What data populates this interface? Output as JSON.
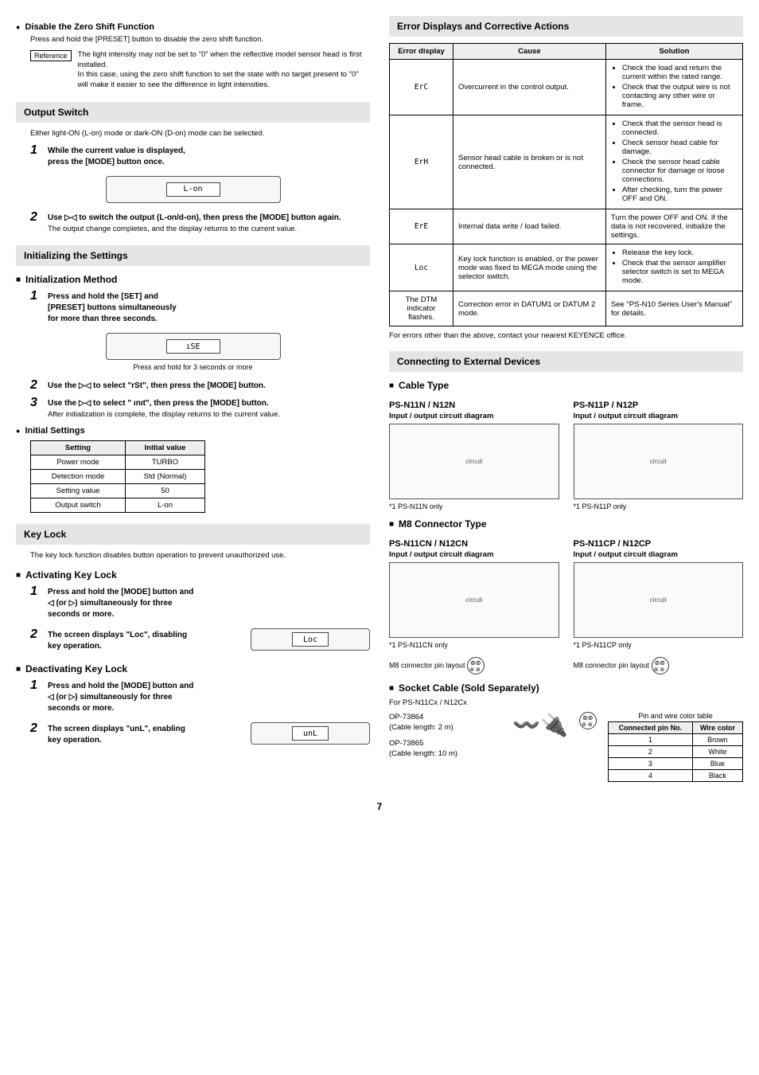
{
  "left": {
    "dz_head": "Disable the Zero Shift Function",
    "dz_body": "Press and hold the [PRESET] button to disable the zero shift function.",
    "ref_label": "Reference",
    "ref_text1": "The light intensity may not be set to \"0\" when the reflective model sensor head is first installed.",
    "ref_text2": "In this case, using the zero shift function to set the state with no target present to \"0\" will make it easier to see the difference in light intensities.",
    "out_sw": "Output Switch",
    "out_sw_body": "Either light-ON (L-on) mode or dark-ON (D-on) mode can be selected.",
    "out_step1a": "While the current value is displayed,",
    "out_step1b": "press the [MODE] button once.",
    "amp_lcd1": "L-on",
    "out_step2": "Use ▷◁ to switch the output (L-on/d-on), then press the [MODE] button again.",
    "out_step2b": "The output change completes, and the display returns to the current value.",
    "init_head": "Initializing the Settings",
    "init_method": "Initialization Method",
    "init_step1a": "Press and hold the [SET] and",
    "init_step1b": "[PRESET] buttons simultaneously",
    "init_step1c": "for more than three seconds.",
    "init_hold": "Press and hold for 3 seconds or more",
    "init_step2": "Use the ▷◁ to select \"rSt\", then press the [MODE] button.",
    "init_step3": "Use the ▷◁ to select \" ınıt\", then press the [MODE] button.",
    "init_step3b": "After initialization is complete, the display returns to the current value.",
    "initset_head": "Initial Settings",
    "settings_h1": "Setting",
    "settings_h2": "Initial value",
    "settings_rows": [
      [
        "Power mode",
        "TURBO"
      ],
      [
        "Detection mode",
        "Std (Normal)"
      ],
      [
        "Setting value",
        "50"
      ],
      [
        "Output switch",
        "L-on"
      ]
    ],
    "keylock_head": "Key Lock",
    "keylock_body": "The key lock function disables button operation to prevent unauthorized use.",
    "act_head": "Activating Key Lock",
    "act_step1": "Press and hold the [MODE] button and ◁ (or ▷) simultaneously for three seconds or more.",
    "act_step2": "The screen displays \"Loc\", disabling key operation.",
    "amp_loc": "Loc",
    "deact_head": "Deactivating Key Lock",
    "deact_step1": "Press and hold the [MODE] button and ◁ (or ▷) simultaneously for three seconds or more.",
    "deact_step2": "The screen displays \"unL\", enabling key operation.",
    "amp_unl": "unL"
  },
  "right": {
    "err_head": "Error Displays and Corrective Actions",
    "err_h1": "Error display",
    "err_h2": "Cause",
    "err_h3": "Solution",
    "err_rows": [
      {
        "d": "ErC",
        "c": "Overcurrent in the control output.",
        "s": [
          "Check the load and return the current within the rated range.",
          "Check that the output wire is not contacting any other wire or frame."
        ]
      },
      {
        "d": "ErH",
        "c": "Sensor head cable is broken or is not connected.",
        "s": [
          "Check that the sensor head is connected.",
          "Check sensor head cable for damage.",
          "Check the sensor head cable connector for damage or loose connections.",
          "After checking, turn the power OFF and ON."
        ]
      },
      {
        "d": "ErE",
        "c": "Internal data write / load failed.",
        "sp": "Turn the power OFF and ON. If the data is not recovered, initialize the settings."
      },
      {
        "d": "Loc",
        "c": "Key lock function is enabled, or the power mode was fixed to MEGA mode using the selector switch.",
        "s": [
          "Release the key lock.",
          "Check that the sensor amplifier selector switch is set to MEGA mode."
        ]
      },
      {
        "d": "The DTM indicator flashes.",
        "c": "Correction error in DATUM1 or DATUM 2 mode.",
        "sp": "See \"PS-N10 Series User's Manual\" for details."
      }
    ],
    "err_note": "For errors other than the above, contact your nearest KEYENCE office.",
    "conn_head": "Connecting to External Devices",
    "cable_type": "Cable Type",
    "n_left": "PS-N11N / N12N",
    "n_right": "PS-N11P / N12P",
    "io_title": "Input / output circuit diagram",
    "foot_n11n": "*1   PS-N11N only",
    "foot_n11p": "*1   PS-N11P only",
    "m8_head": "M8 Connector Type",
    "cn_left": "PS-N11CN / N12CN",
    "cn_right": "PS-N11CP / N12CP",
    "foot_cn": "*1   PS-N11CN only",
    "foot_cp": "*1   PS-N11CP only",
    "m8_layout": "M8 connector pin layout",
    "socket_head": "Socket Cable (Sold Separately)",
    "socket_for": "For PS-N11Cx / N12Cx",
    "op1": "OP-73864",
    "op1b": "(Cable length: 2 m)",
    "op2": "OP-73865",
    "op2b": "(Cable length: 10 m)",
    "pin_table_title": "Pin and wire color table",
    "pin_h1": "Connected pin No.",
    "pin_h2": "Wire color",
    "pin_rows": [
      [
        "1",
        "Brown"
      ],
      [
        "2",
        "White"
      ],
      [
        "3",
        "Blue"
      ],
      [
        "4",
        "Black"
      ]
    ]
  },
  "page_num": "7"
}
